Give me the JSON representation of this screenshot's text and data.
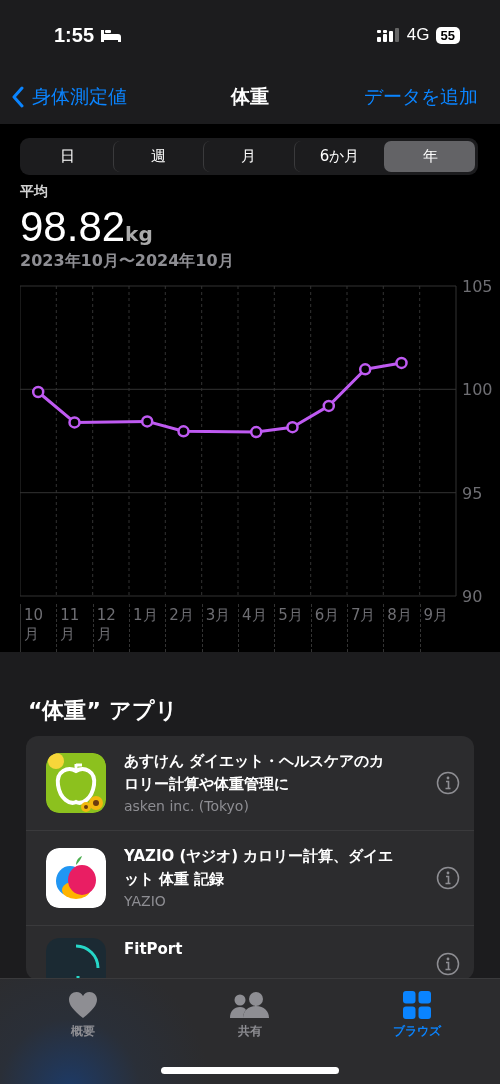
{
  "status_bar": {
    "time": "1:55",
    "network": "4G",
    "battery": "55"
  },
  "nav": {
    "back": "身体測定値",
    "title": "体重",
    "action": "データを追加"
  },
  "periods": [
    {
      "label": "日",
      "selected": false
    },
    {
      "label": "週",
      "selected": false
    },
    {
      "label": "月",
      "selected": false
    },
    {
      "label": "6か月",
      "selected": false
    },
    {
      "label": "年",
      "selected": true
    }
  ],
  "summary": {
    "label": "平均",
    "value": "98.82",
    "unit": "kg",
    "range": "2023年10月〜2024年10月"
  },
  "chart": {
    "chart_data": {
      "type": "line",
      "categories": [
        "10月",
        "11月",
        "12月",
        "1月",
        "2月",
        "3月",
        "4月",
        "5月",
        "6月",
        "7月",
        "8月",
        "9月"
      ],
      "series": [
        {
          "color": "#bf5af2",
          "marker": "circle",
          "values": [
            99.87,
            98.4,
            null,
            98.45,
            97.97,
            null,
            97.93,
            98.17,
            99.2,
            100.97,
            101.28,
            null
          ]
        }
      ],
      "ylim": [
        90,
        105
      ],
      "yticks": [
        90,
        95,
        100,
        105
      ]
    }
  },
  "apps_section": {
    "title": "“体重” アプリ",
    "apps": [
      {
        "name": "あすけん ダイエット・ヘルスケアのカロリー計算や体重管理に",
        "developer": "asken inc. (Tokyo)",
        "kind": "asken"
      },
      {
        "name": "YAZIO (ヤジオ) カロリー計算、ダイエット 体重 記録",
        "developer": "YAZIO",
        "kind": "yazio"
      },
      {
        "name": "FitPort",
        "kind": "fitport"
      }
    ]
  },
  "tab_bar": [
    {
      "label": "概要",
      "kind": "summary",
      "selected": false
    },
    {
      "label": "共有",
      "kind": "sharing",
      "selected": false
    },
    {
      "label": "ブラウズ",
      "kind": "browse",
      "selected": true
    }
  ]
}
